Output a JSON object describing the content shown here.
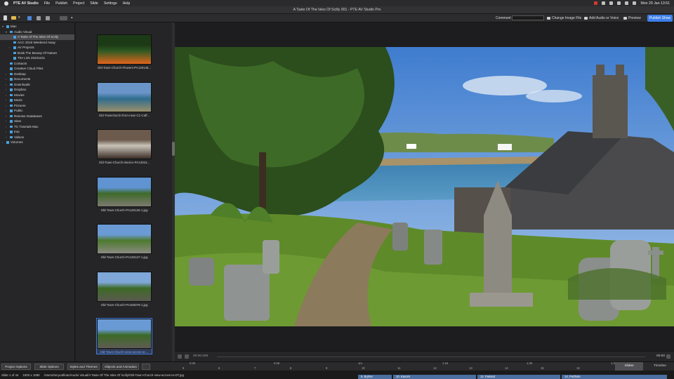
{
  "menubar": {
    "app_name": "PTE AV Studio",
    "items": [
      "File",
      "Publish",
      "Project",
      "Slide",
      "Settings",
      "Help"
    ],
    "clock": "Mon 29 Jan 13:51"
  },
  "window": {
    "title": "A Taste Of The Isles Of Scilly 001 - PTE AV Studio Pro"
  },
  "toolbar": {
    "comment_label": "Comment",
    "change_image_label": "Change Image File",
    "add_audio_label": "Add Audio or Voice",
    "preview_label": "Preview",
    "publish_label": "Publish Show"
  },
  "tree": [
    {
      "label": "Mac",
      "depth": 0,
      "disc": "▾"
    },
    {
      "label": "Audio Visual",
      "depth": 1,
      "disc": "▾"
    },
    {
      "label": "A Taste of The Isles Of Scilly",
      "depth": 2,
      "selected": true
    },
    {
      "label": "ACC 2019 Weekend Away",
      "depth": 2
    },
    {
      "label": "AV Projects",
      "depth": 2,
      "disc": "›"
    },
    {
      "label": "Bosk The Beauty Of Nature",
      "depth": 2
    },
    {
      "label": "The Link 20231101",
      "depth": 2
    },
    {
      "label": "Contacts",
      "depth": 1
    },
    {
      "label": "Creative Cloud Files",
      "depth": 1
    },
    {
      "label": "Desktop",
      "depth": 1,
      "disc": "›"
    },
    {
      "label": "Documents",
      "depth": 1,
      "disc": "›"
    },
    {
      "label": "Downloads",
      "depth": 1,
      "disc": "›"
    },
    {
      "label": "Dropbox",
      "depth": 1,
      "disc": "›"
    },
    {
      "label": "Movies",
      "depth": 1,
      "disc": "›"
    },
    {
      "label": "Music",
      "depth": 1,
      "disc": "›"
    },
    {
      "label": "Pictures",
      "depth": 1,
      "disc": "›"
    },
    {
      "label": "Public",
      "depth": 1,
      "disc": "›"
    },
    {
      "label": "Resolve Databases",
      "depth": 1,
      "disc": "›"
    },
    {
      "label": "Sites",
      "depth": 1,
      "disc": "›"
    },
    {
      "label": "TC Tutorials Mac",
      "depth": 1,
      "disc": "›"
    },
    {
      "label": "tmp",
      "depth": 1,
      "disc": "›"
    },
    {
      "label": "Videos",
      "depth": 1,
      "disc": "›"
    },
    {
      "label": "Volumes",
      "depth": 0,
      "disc": "›"
    }
  ],
  "thumbnails": [
    {
      "caption": "Old-Town-Church-Flowers-PA130145...",
      "palette": [
        "#1d3a16",
        "#2f5a22",
        "#e0641c"
      ],
      "active": false
    },
    {
      "caption": "Old-Townchurch-from-near-C1-Caff...",
      "palette": [
        "#6a95c8",
        "#2f6d8e",
        "#9a8f6a"
      ],
      "active": false
    },
    {
      "caption": "Old-Town-Church-Interior-PA13015...",
      "palette": [
        "#6c5a4c",
        "#c9c3b8",
        "#3a2e26"
      ],
      "active": false
    },
    {
      "caption": "Old-Town-Church-PA130126-1.jpg",
      "palette": [
        "#5f93d2",
        "#3e6a2a",
        "#7d7a70"
      ],
      "active": false
    },
    {
      "caption": "Old-Town-Church-PA130127-1.jpg",
      "palette": [
        "#6b9bd5",
        "#4d7a2e",
        "#8a8a80"
      ],
      "active": false
    },
    {
      "caption": "Old-Town-Church-PA150079-1.jpg",
      "palette": [
        "#7fa7d8",
        "#3d6a26",
        "#5a5a50"
      ],
      "active": false
    },
    {
      "caption": "Old-Town-Church-view-across-to-...",
      "palette": [
        "#6a9ad4",
        "#3b6a26",
        "#605c54"
      ],
      "active": true
    }
  ],
  "player": {
    "time_left": "00:00.000",
    "time_right": "00:00"
  },
  "bottombar": {
    "project_options": "Project Options",
    "slide_options": "Slide Options",
    "styles_themes": "Styles and Themes",
    "objects_animation": "Objects and Animation",
    "slides_tab": "Slides",
    "timeline_tab": "Timeline",
    "ruler_marks": [
      "0:30",
      "0:45",
      "1m",
      "1:15",
      "1:30",
      "1:45"
    ],
    "slide_numbers": [
      "5",
      "6",
      "7",
      "8",
      "9",
      "10",
      "11",
      "12",
      "13",
      "14",
      "15",
      "16"
    ]
  },
  "status": {
    "slide_count": "Slide 1 of 44",
    "dimensions": "1920 x 1080",
    "path": "/Users/tonycullinan/Audio Visual/A Taste Of The Isles Of Scilly/Old-Town-Church-view-across-to-DT.jpg",
    "film_labels": [
      "5. Bryher",
      "10. Kavorn",
      "12. Painted",
      "14. Porthole"
    ]
  }
}
